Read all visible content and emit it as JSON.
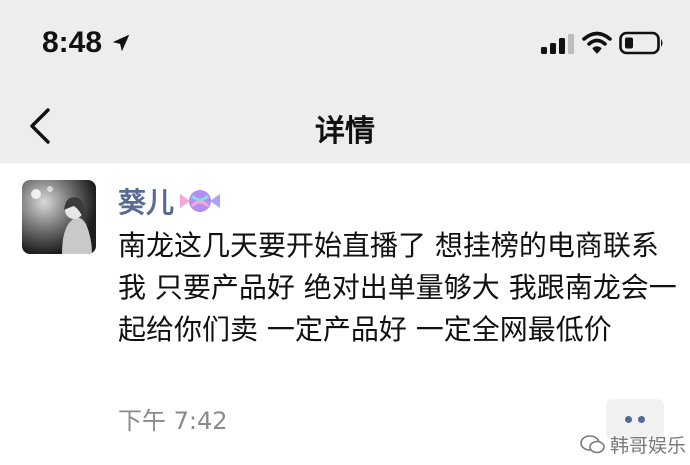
{
  "status_bar": {
    "time": "8:48",
    "location_icon": "location-arrow-icon",
    "signal_icon": "cellular-signal-icon",
    "wifi_icon": "wifi-icon",
    "battery_icon": "battery-low-icon"
  },
  "nav": {
    "back_icon": "chevron-left-icon",
    "title": "详情"
  },
  "post": {
    "username": "葵儿",
    "username_badge_icon": "candy-icon",
    "text": "南龙这几天要开始直播了 想挂榜的电商联系我 只要产品好 绝对出单量够大 我跟南龙会一起给你们卖 一定产品好 一定全网最低价",
    "timestamp": "下午 7:42",
    "more_icon": "more-dots-icon"
  },
  "watermark": {
    "text": "韩哥娱乐",
    "icon": "wechat-channel-icon"
  },
  "colors": {
    "bar_background": "#ededed",
    "username": "#576b95",
    "timestamp": "#8a8a8a"
  }
}
